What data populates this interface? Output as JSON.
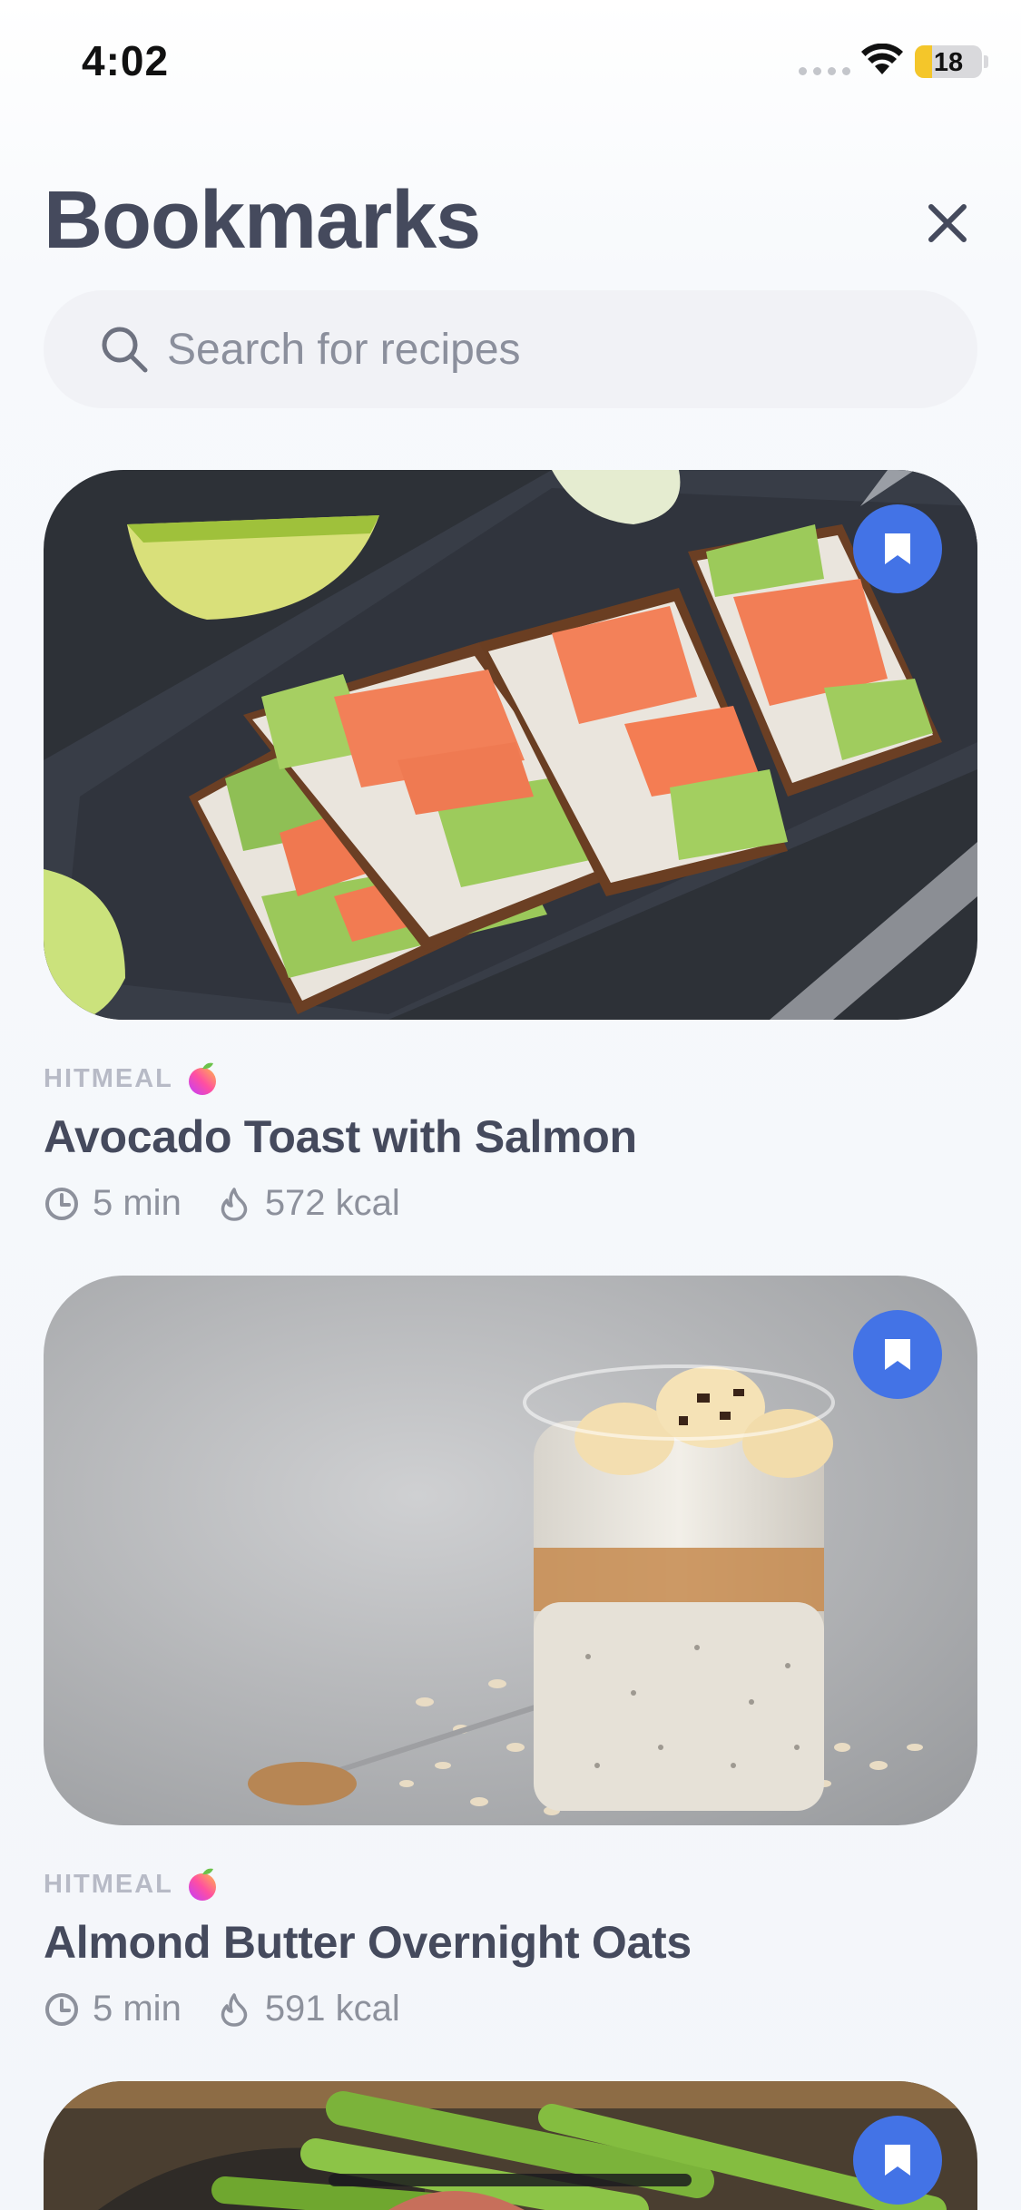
{
  "status_bar": {
    "time": "4:02",
    "battery_level": "18",
    "battery_color": "#f4c62a"
  },
  "header": {
    "title": "Bookmarks",
    "close_icon": "close-icon"
  },
  "search": {
    "placeholder": "Search for recipes",
    "value": ""
  },
  "theme": {
    "accent": "#4373e6",
    "title_color": "#454a5d",
    "muted": "#8d919c",
    "source_color": "#b7bac6"
  },
  "recipes": [
    {
      "source": "HITMEAL",
      "title": "Avocado Toast with Salmon",
      "time": "5 min",
      "calories": "572 kcal",
      "bookmarked": true,
      "icons": [
        "clock-icon",
        "flame-icon",
        "bookmark-icon"
      ]
    },
    {
      "source": "HITMEAL",
      "title": "Almond Butter Overnight Oats",
      "time": "5 min",
      "calories": "591 kcal",
      "bookmarked": true,
      "icons": [
        "clock-icon",
        "flame-icon",
        "bookmark-icon"
      ]
    },
    {
      "bookmarked": true,
      "icons": [
        "bookmark-icon"
      ]
    }
  ]
}
